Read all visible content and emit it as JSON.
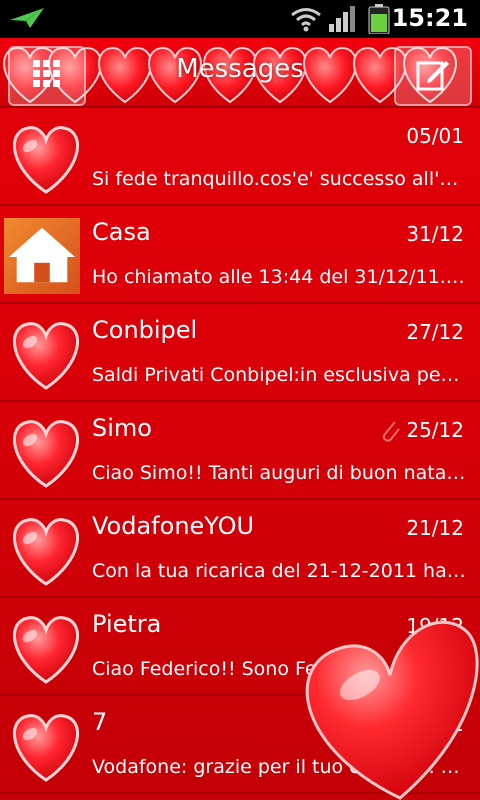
{
  "status_bar": {
    "time": "15:21",
    "icons": [
      "airplane-notification-icon",
      "wifi-icon",
      "signal-icon",
      "battery-icon"
    ]
  },
  "header": {
    "title": "Messages",
    "left_button_icon": "grid-menu-icon",
    "right_button_icon": "compose-icon"
  },
  "colors": {
    "background": "#d80008",
    "divider": "#a80004",
    "text": "#ffffff",
    "heart": "#ff3040"
  },
  "conversations": [
    {
      "name": "",
      "date": "05/01",
      "preview": "Si fede tranquillo.cos'e' successo all'un...",
      "avatar": "heart-avatar-icon",
      "attachment": false
    },
    {
      "name": "Casa",
      "date": "31/12",
      "preview": "Ho chiamato alle 13:44 del 31/12/11. ...",
      "avatar": "house-avatar-icon",
      "attachment": false
    },
    {
      "name": "Conbipel",
      "date": "27/12",
      "preview": "Saldi Privati Conbipel:in esclusiva per t...",
      "avatar": "heart-avatar-icon",
      "attachment": false
    },
    {
      "name": "Simo",
      "date": "25/12",
      "preview": "Ciao Simo!! Tanti auguri di buon natal...",
      "avatar": "heart-avatar-icon",
      "attachment": true
    },
    {
      "name": "VodafoneYOU",
      "date": "21/12",
      "preview": "Con la tua ricarica del 21-12-2011 hai ...",
      "avatar": "heart-avatar-icon",
      "attachment": false
    },
    {
      "name": "Pietra",
      "date": "19/12",
      "preview": "Ciao Federico!! Sono Federico",
      "avatar": "heart-avatar-icon",
      "attachment": false
    },
    {
      "name": "7",
      "date": "13/12",
      "preview": "Vodafone: grazie per il tuo contatto. P...",
      "avatar": "heart-avatar-icon",
      "attachment": false
    }
  ]
}
